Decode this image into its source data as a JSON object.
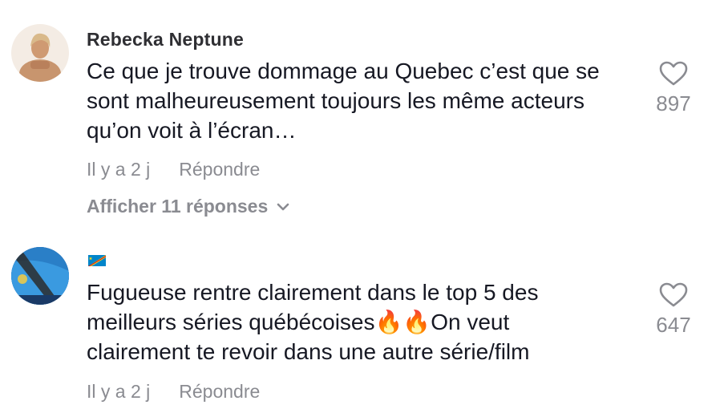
{
  "comments": [
    {
      "username": "Rebecka Neptune",
      "text": "Ce que je trouve dommage au Quebec c’est que se\nsont malheureusement toujours les même acteurs\nqu’on voit à l’écran…",
      "time": "Il y a 2 j",
      "reply_label": "Répondre",
      "view_replies": "Afficher 11 réponses",
      "likes": "897"
    },
    {
      "username": "",
      "text": "Fugueuse rentre clairement dans le top 5 des\nmeilleurs séries québécoises🔥🔥On veut\nclairement te revoir dans une autre série/film",
      "time": "Il y a 2 j",
      "reply_label": "Répondre",
      "likes": "647"
    }
  ],
  "colors": {
    "text": "#161823",
    "muted": "#8a8b91",
    "username": "#2f2f33"
  },
  "icons": [
    "heart-outline-icon",
    "chevron-down-icon",
    "drc-flag-icon"
  ]
}
